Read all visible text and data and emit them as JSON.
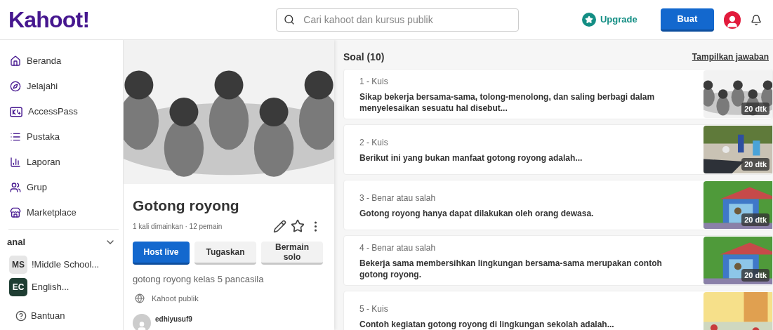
{
  "header": {
    "logo": "Kahoot!",
    "search": {
      "placeholder": "Cari kahoot dan kursus publik"
    },
    "upgrade": "Upgrade",
    "create_button": "Buat"
  },
  "sidebar": {
    "items": [
      {
        "label": "Beranda"
      },
      {
        "label": "Jelajahi"
      },
      {
        "label": "AccessPass"
      },
      {
        "label": "Pustaka"
      },
      {
        "label": "Laporan"
      },
      {
        "label": "Grup"
      },
      {
        "label": "Marketplace"
      }
    ],
    "channels_heading": "anal",
    "channels": [
      {
        "initials": "MS",
        "name": "!Middle School...",
        "color": "#e6e6e6"
      },
      {
        "initials": "EC",
        "name": "English...",
        "color": "#1e3d32"
      }
    ],
    "help": "Bantuan"
  },
  "kahoot": {
    "title": "Gotong royong",
    "stats": "1 kali dimainkan · 12 pemain",
    "buttons": [
      {
        "label": "Host live",
        "kind": "primary"
      },
      {
        "label": "Tugaskan",
        "kind": "secondary"
      },
      {
        "label": "Bermain solo",
        "kind": "secondary"
      }
    ],
    "description": "gotong royong kelas 5 pancasila",
    "visibility": "Kahoot publik",
    "creator": "edhiyusuf9"
  },
  "questions": {
    "heading": "Soal (10)",
    "show_answers": "Tampilkan jawaban",
    "items": [
      {
        "label": "1 - Kuis",
        "text": "Sikap bekerja bersama-sama, tolong-menolong, dan saling berbagi dalam menyelesaikan sesuatu hal disebut...",
        "time": "20 dtk"
      },
      {
        "label": "2 - Kuis",
        "text": "Berikut ini yang bukan manfaat gotong royong adalah...",
        "time": "20 dtk"
      },
      {
        "label": "3 - Benar atau salah",
        "text": "Gotong royong hanya dapat dilakukan oleh orang dewasa.",
        "time": "20 dtk"
      },
      {
        "label": "4 - Benar atau salah",
        "text": "Bekerja sama membersihkan lingkungan bersama-sama merupakan contoh gotong royong.",
        "time": "20 dtk"
      },
      {
        "label": "5 - Kuis",
        "text": "Contoh kegiatan gotong royong di lingkungan sekolah adalah..."
      }
    ]
  }
}
